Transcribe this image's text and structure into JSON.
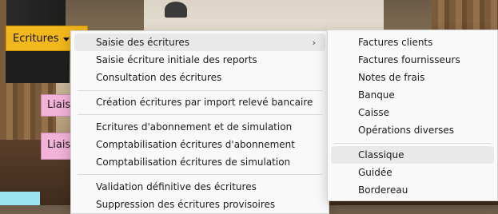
{
  "app": {
    "ecritures_label": "Ecritures",
    "liais_labels": [
      "Liais",
      "Liais"
    ]
  },
  "main_menu": {
    "items": [
      "Saisie des écritures",
      "Saisie écriture initiale des reports",
      "Consultation des écritures",
      "Création écritures par import relevé bancaire",
      "Ecritures d'abonnement et de simulation",
      "Comptabilisation écritures d'abonnement",
      "Comptabilisation écritures de simulation",
      "Validation définitive des écritures",
      "Suppression des écritures provisoires"
    ],
    "submenu_chevron": "›"
  },
  "sub_menu": {
    "items": [
      "Factures clients",
      "Factures fournisseurs",
      "Notes de frais",
      "Banque",
      "Caisse",
      "Opérations diverses",
      "Classique",
      "Guidée",
      "Bordereau"
    ]
  },
  "colors": {
    "ecritures_button": "#f2b71a",
    "liais_tile": "#f2b1d6",
    "menu_background": "#f9f9f9",
    "active_item": "#e9e9e9"
  }
}
